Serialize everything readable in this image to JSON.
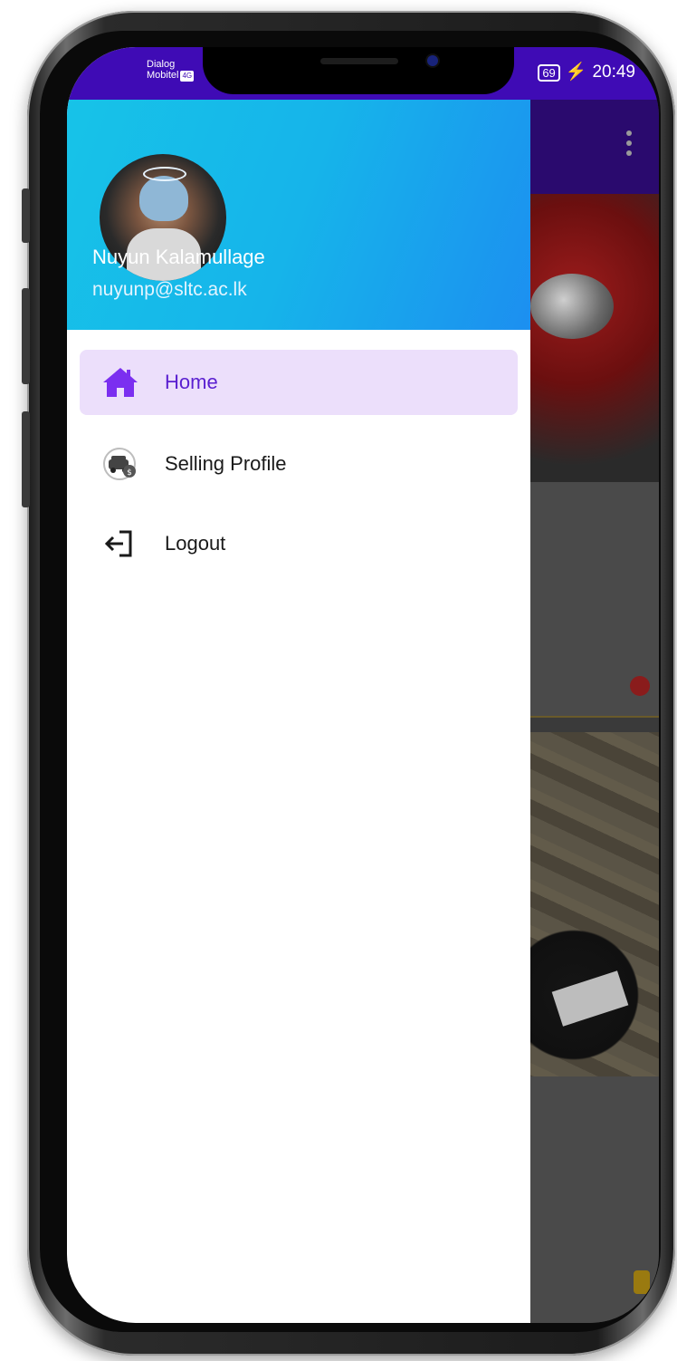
{
  "status_bar": {
    "carrier_line1": "Dialog",
    "carrier_line2": "Mobitel",
    "network_badge": "4G",
    "battery": "69",
    "time": "20:49"
  },
  "drawer": {
    "user": {
      "name": "Nuyun Kalamullage",
      "email": "nuyunp@sltc.ac.lk"
    },
    "items": [
      {
        "label": "Home",
        "icon": "home-icon",
        "active": true
      },
      {
        "label": "Selling Profile",
        "icon": "car-sell-icon",
        "active": false
      },
      {
        "label": "Logout",
        "icon": "logout-icon",
        "active": false
      }
    ]
  },
  "colors": {
    "status_bar": "#3f0bb5",
    "header_start": "#17c3e8",
    "header_end": "#1c8ff0",
    "active_bg": "#ecdffb",
    "accent": "#7b2ff0"
  }
}
